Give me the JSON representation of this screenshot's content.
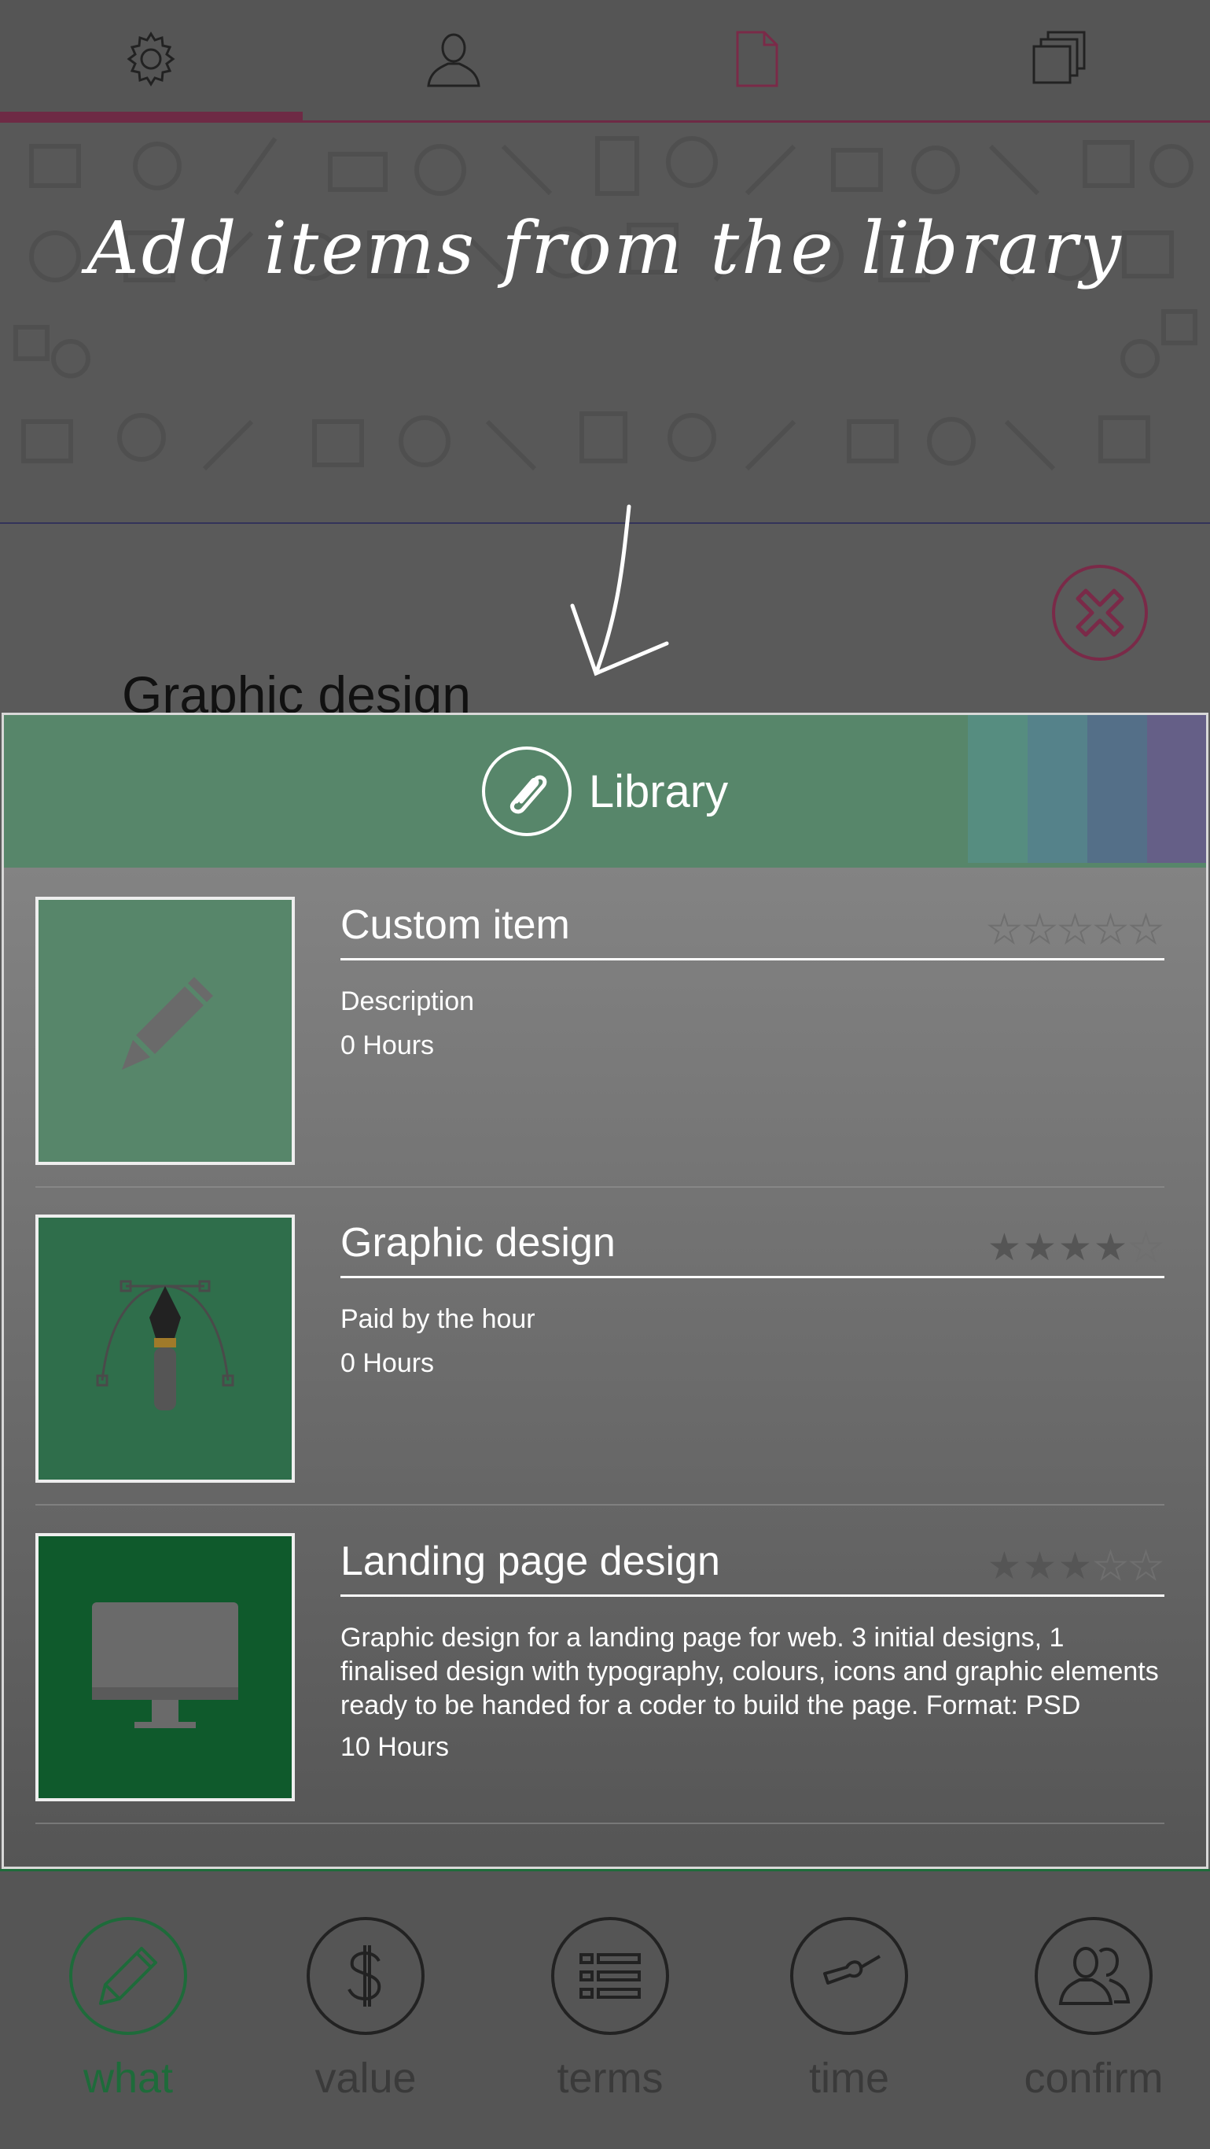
{
  "top_tabs": [
    {
      "icon": "gear-icon"
    },
    {
      "icon": "user-icon"
    },
    {
      "icon": "document-icon"
    },
    {
      "icon": "copies-icon"
    }
  ],
  "tutorial": {
    "text": "Add items from the library"
  },
  "behind": {
    "title": "Graphic design"
  },
  "library": {
    "title": "Library",
    "header_color": "#57866a",
    "items": [
      {
        "name": "Custom item",
        "description": "Description",
        "hours": "0 Hours",
        "rating": 0,
        "rating_max": 5,
        "icon": "pencil-icon"
      },
      {
        "name": "Graphic design",
        "description": "Paid by the hour",
        "hours": "0 Hours",
        "rating": 4,
        "rating_max": 5,
        "icon": "pen-tool-icon"
      },
      {
        "name": "Landing page design",
        "description": "Graphic design for a landing page for web. 3 initial designs, 1 finalised design with typography, colours, icons and graphic elements ready to be handed for a coder to build the page. Format: PSD",
        "hours": "10 Hours",
        "rating": 3,
        "rating_max": 5,
        "icon": "monitor-icon"
      }
    ]
  },
  "bottom_nav": [
    {
      "label": "what",
      "icon": "pen-icon",
      "active": true
    },
    {
      "label": "value",
      "icon": "dollar-icon",
      "active": false
    },
    {
      "label": "terms",
      "icon": "list-icon",
      "active": false
    },
    {
      "label": "time",
      "icon": "clock-icon",
      "active": false
    },
    {
      "label": "confirm",
      "icon": "users-icon",
      "active": false
    }
  ],
  "colors": {
    "accent": "#6e2a45",
    "active_nav": "#1e6b3a",
    "library_header": "#57866a"
  }
}
